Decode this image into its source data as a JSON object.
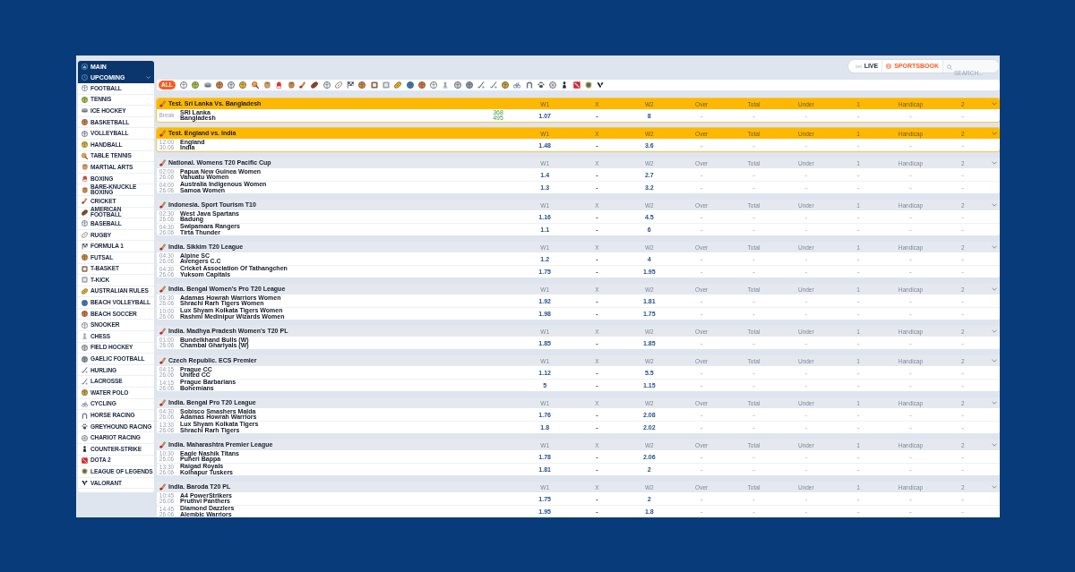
{
  "top_bar": {
    "tabs": [
      {
        "label": "LIVE",
        "selected": false
      },
      {
        "label": "SPORTSBOOK",
        "selected": true
      }
    ],
    "search": {
      "placeholder": "SEARCH..."
    }
  },
  "sidebar": {
    "sections": [
      {
        "label": "MAIN"
      },
      {
        "label": "UPCOMING",
        "expanded": true
      }
    ],
    "sports": [
      {
        "label": "FOOTBALL"
      },
      {
        "label": "TENNIS"
      },
      {
        "label": "ICE HOCKEY"
      },
      {
        "label": "BASKETBALL"
      },
      {
        "label": "VOLLEYBALL"
      },
      {
        "label": "HANDBALL"
      },
      {
        "label": "TABLE TENNIS"
      },
      {
        "label": "MARTIAL ARTS"
      },
      {
        "label": "BOXING"
      },
      {
        "label": "BARE-KNUCKLE BOXING"
      },
      {
        "label": "CRICKET"
      },
      {
        "label": "AMERICAN FOOTBALL"
      },
      {
        "label": "BASEBALL"
      },
      {
        "label": "RUGBY"
      },
      {
        "label": "FORMULA 1"
      },
      {
        "label": "FUTSAL"
      },
      {
        "label": "T-BASKET"
      },
      {
        "label": "T-KICK"
      },
      {
        "label": "AUSTRALIAN RULES"
      },
      {
        "label": "BEACH VOLLEYBALL"
      },
      {
        "label": "BEACH SOCCER"
      },
      {
        "label": "SNOOKER"
      },
      {
        "label": "CHESS"
      },
      {
        "label": "FIELD HOCKEY"
      },
      {
        "label": "GAELIC FOOTBALL"
      },
      {
        "label": "HURLING"
      },
      {
        "label": "LACROSSE"
      },
      {
        "label": "WATER POLO"
      },
      {
        "label": "CYCLING"
      },
      {
        "label": "HORSE RACING"
      },
      {
        "label": "GREYHOUND RACING"
      },
      {
        "label": "CHARIOT RACING"
      },
      {
        "label": "COUNTER-STRIKE"
      },
      {
        "label": "DOTA 2"
      },
      {
        "label": "LEAGUE OF LEGENDS"
      },
      {
        "label": "VALORANT"
      }
    ]
  },
  "sport_filter": {
    "all": {
      "label": "ALL",
      "selected": true
    }
  },
  "leagues": [
    {
      "title": "Test. Sri Lanka Vs. Bangladesh",
      "featured": true,
      "columns": [
        "W1",
        "X",
        "W2",
        "Over",
        "Total",
        "Under",
        "1",
        "Handicap",
        "2"
      ],
      "matches": [
        {
          "time": "Break",
          "team_1": "SRI Lanka",
          "team_2": "Bangladesh",
          "score_1": "368",
          "score_2": "495",
          "odds": [
            "1.07",
            "-",
            "8",
            "-",
            "-",
            "-",
            "-",
            "-",
            "-"
          ]
        }
      ]
    },
    {
      "title": "Test. England vs. India",
      "featured": true,
      "columns": [
        "W1",
        "X",
        "W2",
        "Over",
        "Total",
        "Under",
        "1",
        "Handicap",
        "2"
      ],
      "matches": [
        {
          "time": "12:00",
          "date": "30.06",
          "team_1": "England",
          "team_2": "India",
          "odds": [
            "1.48",
            "-",
            "3.6",
            "-",
            "-",
            "-",
            "-",
            "-",
            "-"
          ]
        }
      ]
    },
    {
      "title": "National. Womens T20 Pacific Cup",
      "featured": false,
      "columns": [
        "W1",
        "X",
        "W2",
        "Over",
        "Total",
        "Under",
        "1",
        "Handicap",
        "2"
      ],
      "matches": [
        {
          "time": "02:00",
          "date": "26.06",
          "team_1": "Papua New Guinea Women",
          "team_2": "Vanuatu Women",
          "odds": [
            "1.4",
            "-",
            "2.7",
            "-",
            "-",
            "-",
            "-",
            "-",
            "-"
          ]
        },
        {
          "time": "04:00",
          "date": "26.06",
          "team_1": "Australia Indigenous Women",
          "team_2": "Samoa Women",
          "odds": [
            "1.3",
            "-",
            "3.2",
            "-",
            "-",
            "-",
            "-",
            "-",
            "-"
          ]
        }
      ]
    },
    {
      "title": "Indonesia. Sport Tourism T10",
      "featured": false,
      "columns": [
        "W1",
        "X",
        "W2",
        "Over",
        "Total",
        "Under",
        "1",
        "Handicap",
        "2"
      ],
      "matches": [
        {
          "time": "02:30",
          "date": "26.06",
          "team_1": "West Java Spartans",
          "team_2": "Badung",
          "odds": [
            "1.16",
            "-",
            "4.5",
            "-",
            "-",
            "-",
            "-",
            "-",
            "-"
          ]
        },
        {
          "time": "04:30",
          "date": "26.06",
          "team_1": "Swipamara Rangers",
          "team_2": "Tirta Thunder",
          "odds": [
            "1.1",
            "-",
            "6",
            "-",
            "-",
            "-",
            "-",
            "-",
            "-"
          ]
        }
      ]
    },
    {
      "title": "India. Sikkim T20 League",
      "featured": false,
      "columns": [
        "W1",
        "X",
        "W2",
        "Over",
        "Total",
        "Under",
        "1",
        "Handicap",
        "2"
      ],
      "matches": [
        {
          "time": "04:30",
          "date": "26.06",
          "team_1": "Alpine SC",
          "team_2": "Avengers C.C",
          "odds": [
            "1.2",
            "-",
            "4",
            "-",
            "-",
            "-",
            "-",
            "-",
            "-"
          ]
        },
        {
          "time": "04:30",
          "date": "26.06",
          "team_1": "Cricket Association Of Tathangchen",
          "team_2": "Yuksom Capitals",
          "odds": [
            "1.75",
            "-",
            "1.95",
            "-",
            "-",
            "-",
            "-",
            "-",
            "-"
          ]
        }
      ]
    },
    {
      "title": "India. Bengal Women's Pro T20 League",
      "featured": false,
      "columns": [
        "W1",
        "X",
        "W2",
        "Over",
        "Total",
        "Under",
        "1",
        "Handicap",
        "2"
      ],
      "matches": [
        {
          "time": "06:30",
          "date": "26.06",
          "team_1": "Adamas Howrah Warriors Women",
          "team_2": "Shrachi Rarh Tigers Women",
          "odds": [
            "1.92",
            "-",
            "1.81",
            "-",
            "-",
            "-",
            "-",
            "-",
            "-"
          ]
        },
        {
          "time": "10:00",
          "date": "26.06",
          "team_1": "Lux Shyam Kolkata Tigers Women",
          "team_2": "Rashmi Medinipur Wizards Women",
          "odds": [
            "1.98",
            "-",
            "1.75",
            "-",
            "-",
            "-",
            "-",
            "-",
            "-"
          ]
        }
      ]
    },
    {
      "title": "India. Madhya Pradesh Women's T20 PL",
      "featured": false,
      "columns": [
        "W1",
        "X",
        "W2",
        "Over",
        "Total",
        "Under",
        "1",
        "Handicap",
        "2"
      ],
      "matches": [
        {
          "time": "01:00",
          "date": "26.06",
          "team_1": "Bundelkhand Bulls (W)",
          "team_2": "Chambal Ghariyals (W)",
          "odds": [
            "1.85",
            "-",
            "1.85",
            "-",
            "-",
            "-",
            "-",
            "-",
            "-"
          ]
        }
      ]
    },
    {
      "title": "Czech Republic. ECS Premier",
      "featured": false,
      "columns": [
        "W1",
        "X",
        "W2",
        "Over",
        "Total",
        "Under",
        "1",
        "Handicap",
        "2"
      ],
      "matches": [
        {
          "time": "04:15",
          "date": "26.06",
          "team_1": "Prague CC",
          "team_2": "United CC",
          "odds": [
            "1.12",
            "-",
            "5.5",
            "-",
            "-",
            "-",
            "-",
            "-",
            "-"
          ]
        },
        {
          "time": "14:15",
          "date": "26.06",
          "team_1": "Prague Barbarians",
          "team_2": "Bohemians",
          "odds": [
            "5",
            "-",
            "1.15",
            "-",
            "-",
            "-",
            "-",
            "-",
            "-"
          ]
        }
      ]
    },
    {
      "title": "India. Bengal Pro T20 League",
      "featured": false,
      "columns": [
        "W1",
        "X",
        "W2",
        "Over",
        "Total",
        "Under",
        "1",
        "Handicap",
        "2"
      ],
      "matches": [
        {
          "time": "04:30",
          "date": "26.06",
          "team_1": "Sobisco Smashers Malda",
          "team_2": "Adamas Howrah Warriors",
          "odds": [
            "1.76",
            "-",
            "2.08",
            "-",
            "-",
            "-",
            "-",
            "-",
            "-"
          ]
        },
        {
          "time": "13:30",
          "date": "26.06",
          "team_1": "Lux Shyam Kolkata Tigers",
          "team_2": "Shrachi Rarh Tigers",
          "odds": [
            "1.8",
            "-",
            "2.02",
            "-",
            "-",
            "-",
            "-",
            "-",
            "-"
          ]
        }
      ]
    },
    {
      "title": "India. Maharashtra Premier League",
      "featured": false,
      "columns": [
        "W1",
        "X",
        "W2",
        "Over",
        "Total",
        "Under",
        "1",
        "Handicap",
        "2"
      ],
      "matches": [
        {
          "time": "10:30",
          "date": "26.06",
          "team_1": "Eagle Nashik Titans",
          "team_2": "Puneri Bappa",
          "odds": [
            "1.78",
            "-",
            "2.06",
            "-",
            "-",
            "-",
            "-",
            "-",
            "-"
          ]
        },
        {
          "time": "13:30",
          "date": "26.06",
          "team_1": "Raigad Royals",
          "team_2": "Kolhapur Tuskers",
          "odds": [
            "1.81",
            "-",
            "2",
            "-",
            "-",
            "-",
            "-",
            "-",
            "-"
          ]
        }
      ]
    },
    {
      "title": "India. Baroda T20 PL",
      "featured": false,
      "columns": [
        "W1",
        "X",
        "W2",
        "Over",
        "Total",
        "Under",
        "1",
        "Handicap",
        "2"
      ],
      "matches": [
        {
          "time": "10:45",
          "date": "26.06",
          "team_1": "A4 PowerStrikers",
          "team_2": "Pruthvi Panthers",
          "odds": [
            "1.75",
            "-",
            "2",
            "-",
            "-",
            "-",
            "-",
            "-",
            "-"
          ]
        },
        {
          "time": "14:45",
          "date": "26.06",
          "team_1": "Diamond Dazzlers",
          "team_2": "Alembic Warriors",
          "odds": [
            "1.95",
            "-",
            "1.8",
            "-",
            "-",
            "-",
            "-",
            "-",
            "-"
          ]
        }
      ]
    }
  ]
}
